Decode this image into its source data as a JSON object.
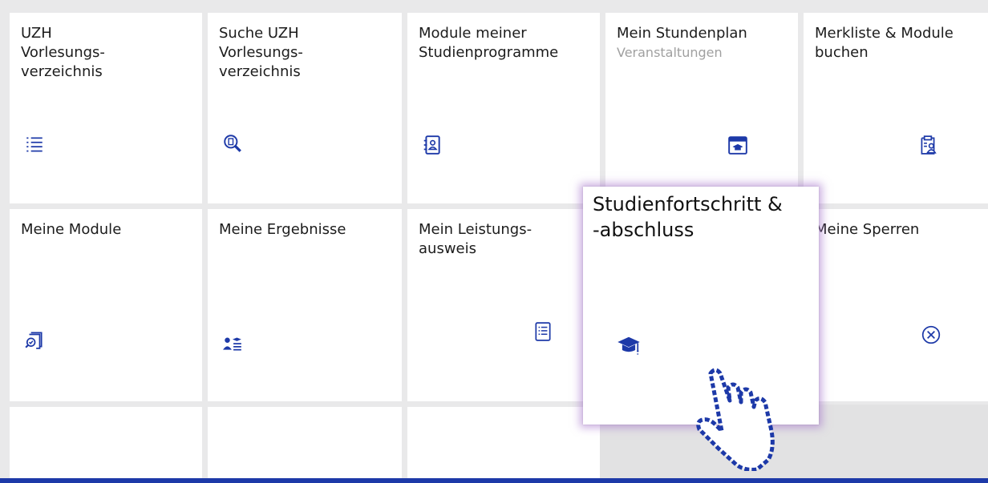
{
  "tiles": [
    {
      "id": "uzh-vorlesungsverzeichnis",
      "lines": [
        "UZH",
        "Vorlesungs-",
        "verzeichnis"
      ],
      "icon": "list-icon"
    },
    {
      "id": "suche-uzh-vorlesungsverzeichnis",
      "lines": [
        "Suche UZH",
        "Vorlesungs-",
        "verzeichnis"
      ],
      "icon": "search-document-icon"
    },
    {
      "id": "module-meiner-studienprogramme",
      "lines": [
        "Module meiner",
        "Studienprogramme"
      ],
      "icon": "address-book-icon"
    },
    {
      "id": "mein-stundenplan",
      "lines": [
        "Mein Stundenplan"
      ],
      "subtitle": "Veranstaltungen",
      "icon": "calendar-graduation-icon"
    },
    {
      "id": "merkliste-module-buchen",
      "lines": [
        "Merkliste & Module",
        "buchen"
      ],
      "icon": "clipboard-person-icon"
    },
    {
      "id": "meine-module",
      "lines": [
        "Meine Module"
      ],
      "icon": "modules-search-icon"
    },
    {
      "id": "meine-ergebnisse",
      "lines": [
        "Meine Ergebnisse"
      ],
      "icon": "student-results-icon"
    },
    {
      "id": "mein-leistungsausweis",
      "lines": [
        "Mein Leistungs-",
        "ausweis"
      ],
      "icon": "document-list-icon"
    },
    {
      "id": "meine-sperren",
      "lines": [
        "Meine Sperren"
      ],
      "icon": "cancel-circle-icon"
    }
  ],
  "popup": {
    "lines": [
      "Studienfortschritt &",
      "-abschluss"
    ],
    "icon": "graduation-cap-icon"
  },
  "cursor": "pointing-hand-cursor-icon",
  "colors": {
    "accent": "#1d39a8",
    "background": "#e9e9ea",
    "tile": "#ffffff",
    "subtitle": "#a0a0a0",
    "glow": "#a06ec8"
  }
}
